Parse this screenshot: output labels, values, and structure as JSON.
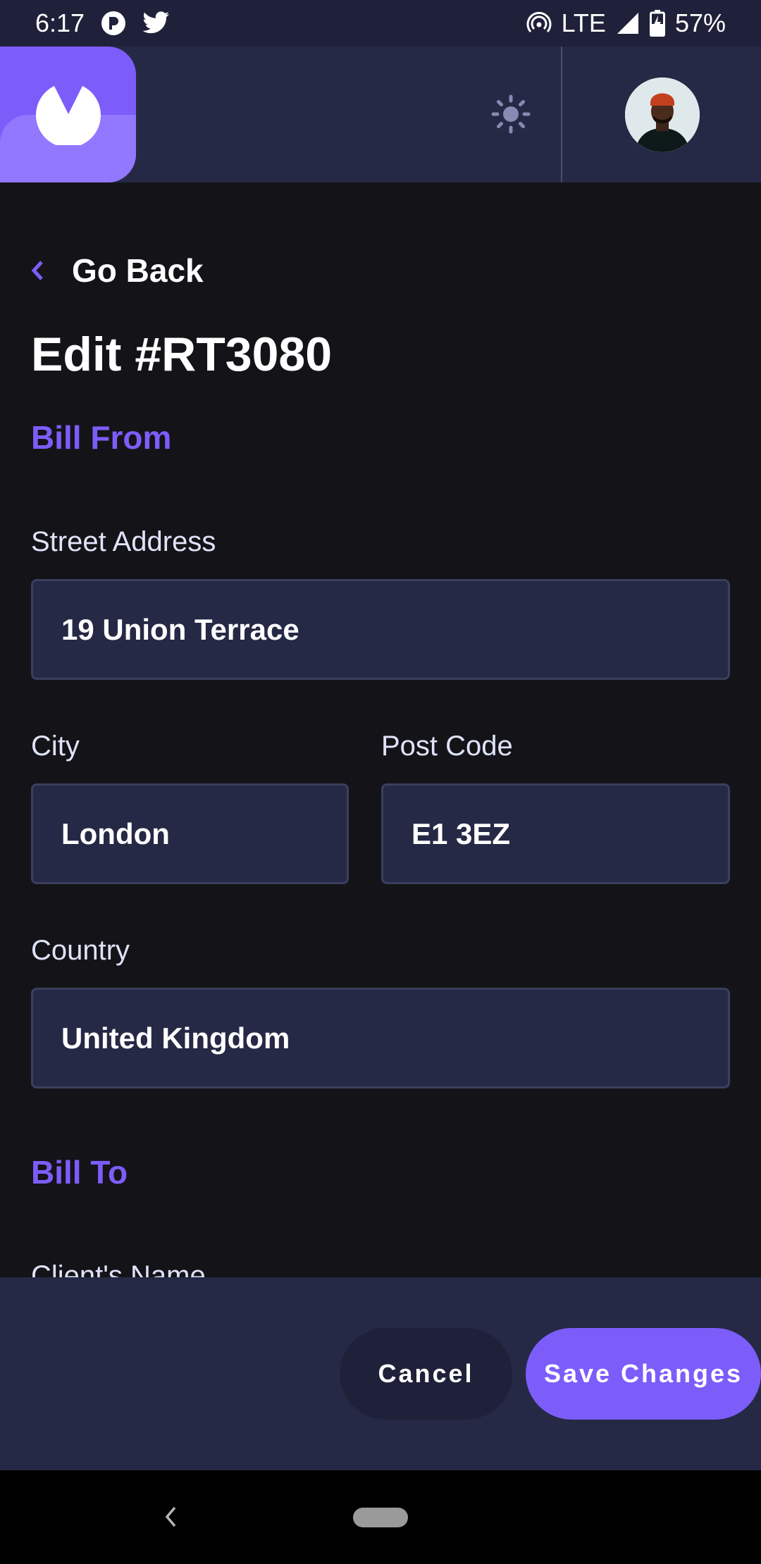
{
  "status_bar": {
    "time": "6:17",
    "network": "LTE",
    "battery": "57%"
  },
  "header": {
    "logo_icon": "invoice-app-logo",
    "theme_icon": "sun-icon",
    "avatar_icon": "user-avatar"
  },
  "nav": {
    "back_label": "Go Back"
  },
  "page": {
    "title": "Edit #RT3080"
  },
  "bill_from": {
    "section_title": "Bill From",
    "street_label": "Street Address",
    "street_value": "19 Union Terrace",
    "city_label": "City",
    "city_value": "London",
    "postcode_label": "Post Code",
    "postcode_value": "E1 3EZ",
    "country_label": "Country",
    "country_value": "United Kingdom"
  },
  "bill_to": {
    "section_title": "Bill To",
    "client_name_label": "Client's Name"
  },
  "footer": {
    "cancel_label": "Cancel",
    "save_label": "Save Changes"
  },
  "colors": {
    "accent": "#7c5dfa",
    "header_bg": "#252945",
    "page_bg": "#141418"
  }
}
